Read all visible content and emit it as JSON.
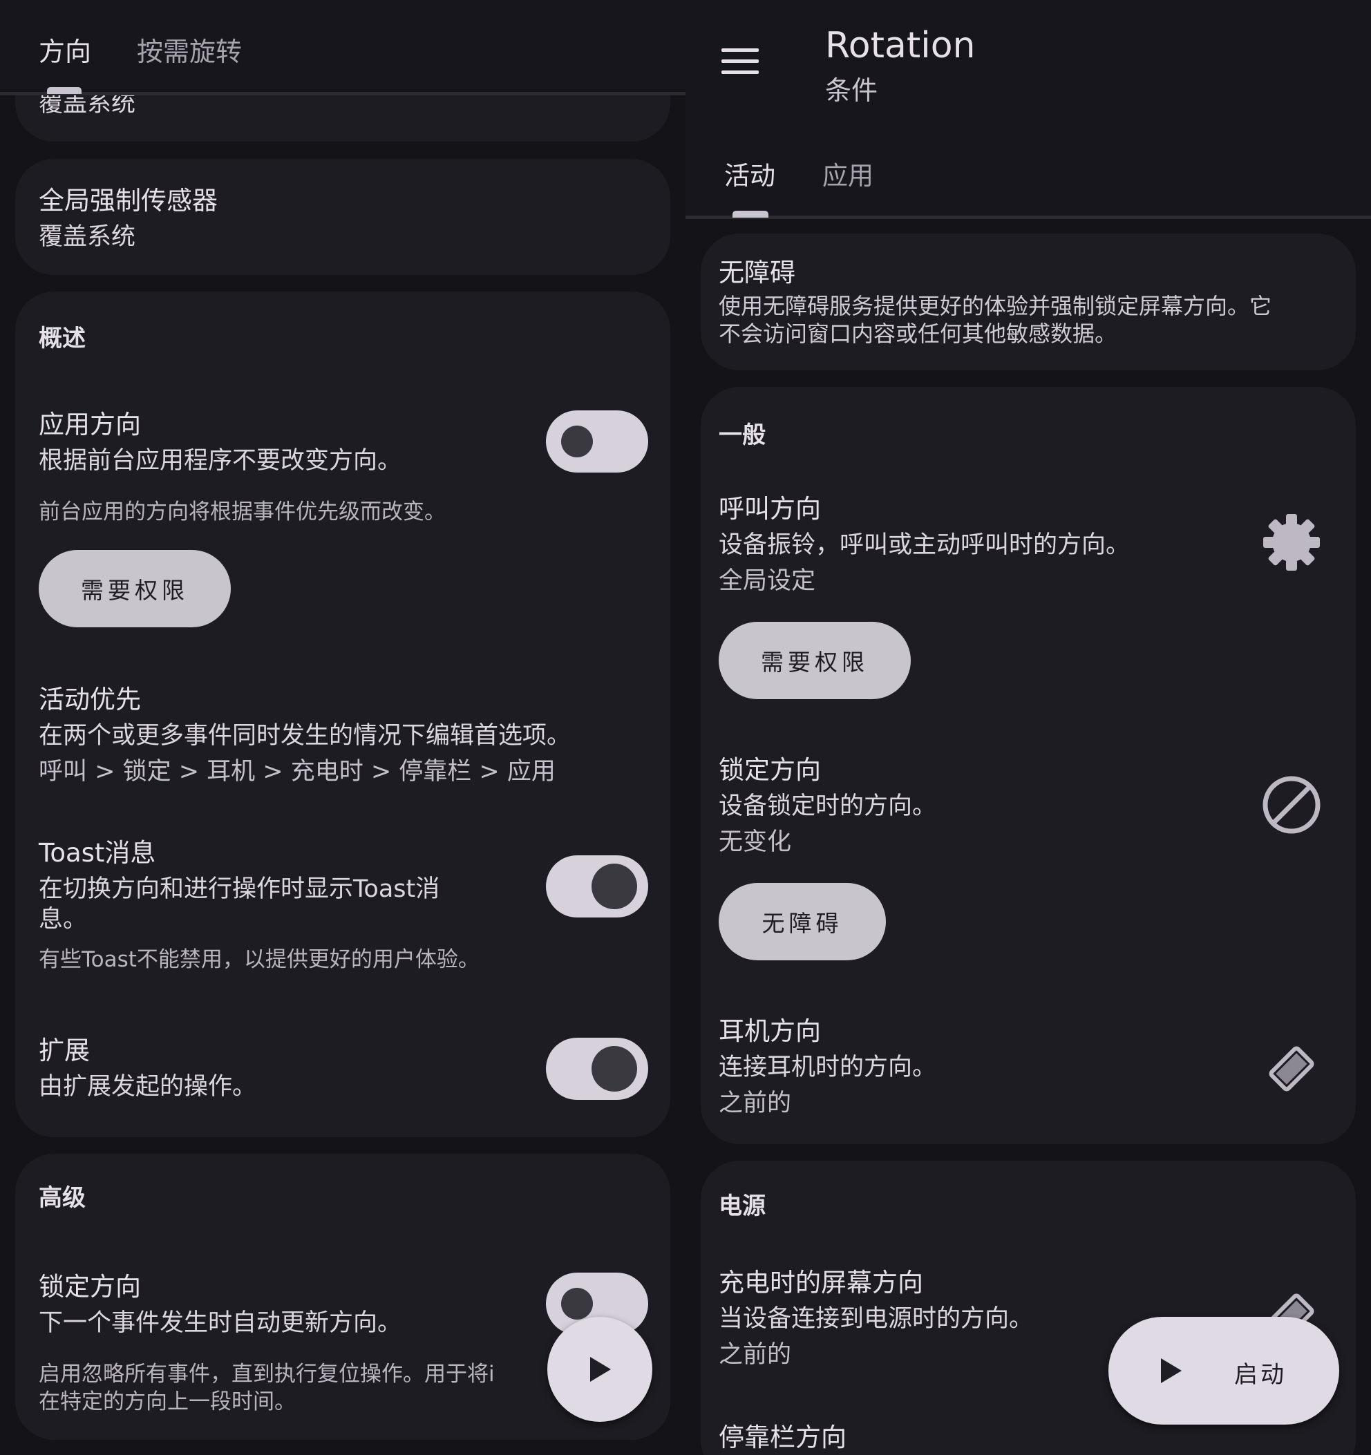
{
  "left": {
    "tabs": [
      "方向",
      "按需旋转"
    ],
    "partial_card_text": "覆盖系统",
    "global_sensor": {
      "title": "全局强制传感器",
      "subtitle": "覆盖系统"
    },
    "overview": {
      "header": "概述",
      "app_orientation": {
        "title": "应用方向",
        "subtitle": "根据前台应用程序不要改变方向。",
        "note": "前台应用的方向将根据事件优先级而改变。",
        "button": "需要权限",
        "toggle": "off"
      },
      "event_priority": {
        "title": "活动优先",
        "subtitle": "在两个或更多事件同时发生的情况下编辑首选项。",
        "value": "呼叫 > 锁定 > 耳机 > 充电时 > 停靠栏 > 应用"
      },
      "toast": {
        "title": "Toast消息",
        "subtitle_line1": "在切换方向和进行操作时显示Toast消",
        "subtitle_line2": "息。",
        "note": "有些Toast不能禁用，以提供更好的用户体验。",
        "toggle": "on"
      },
      "extension": {
        "title": "扩展",
        "subtitle": "由扩展发起的操作。",
        "toggle": "on"
      }
    },
    "advanced": {
      "header": "高级",
      "lock_orientation": {
        "title": "锁定方向",
        "subtitle": "下一个事件发生时自动更新方向。",
        "note_line1": "启用忽略所有事件，直到执行复位操作。用于将i",
        "note_line2": "在特定的方向上一段时间。",
        "toggle": "off"
      }
    },
    "fab_icon": "play-icon"
  },
  "right": {
    "app_title": "Rotation",
    "app_subtitle": "条件",
    "tabs": [
      "活动",
      "应用"
    ],
    "accessibility_card": {
      "title": "无障碍",
      "desc_line1": "使用无障碍服务提供更好的体验并强制锁定屏幕方向。它",
      "desc_line2": "不会访问窗口内容或任何其他敏感数据。"
    },
    "general": {
      "header": "一般",
      "call": {
        "title": "呼叫方向",
        "subtitle": "设备振铃，呼叫或主动呼叫时的方向。",
        "value": "全局设定",
        "button": "需要权限",
        "icon": "gear-icon"
      },
      "lock": {
        "title": "锁定方向",
        "subtitle": "设备锁定时的方向。",
        "value": "无变化",
        "button": "无障碍",
        "icon": "block-icon"
      },
      "headset": {
        "title": "耳机方向",
        "subtitle": "连接耳机时的方向。",
        "value": "之前的",
        "icon": "rotation-previous-icon"
      }
    },
    "power": {
      "header": "电源",
      "charging": {
        "title": "充电时的屏幕方向",
        "subtitle": "当设备连接到电源时的方向。",
        "value": "之前的",
        "icon": "rotation-previous-icon"
      },
      "dock": {
        "title": "停靠栏方向"
      }
    },
    "fab": {
      "label": "启动",
      "icon": "play-icon"
    }
  }
}
